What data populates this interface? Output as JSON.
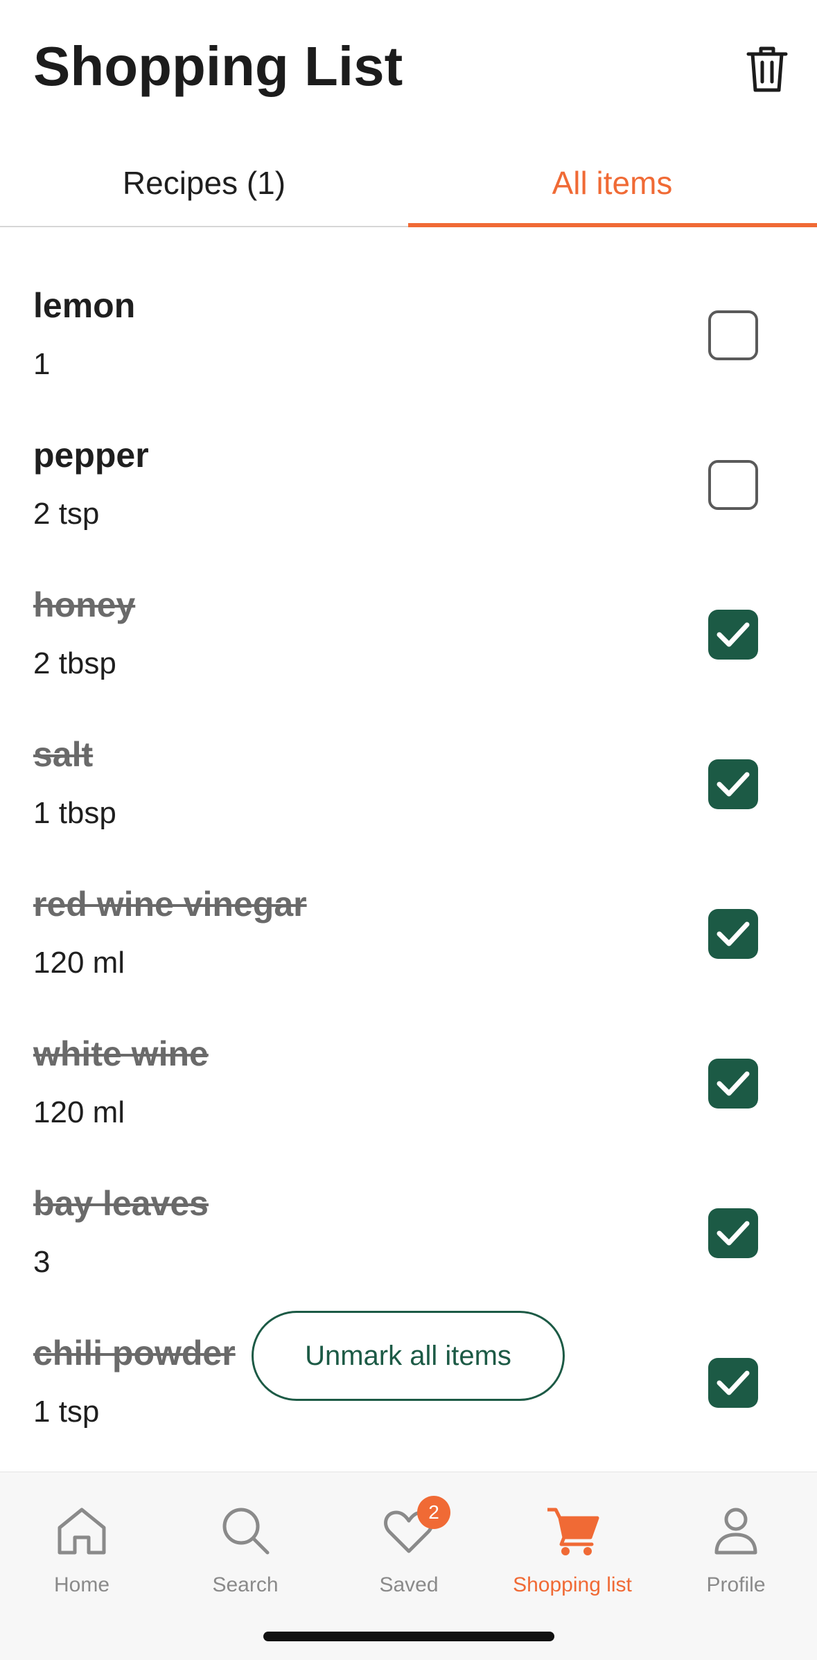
{
  "header": {
    "title": "Shopping List"
  },
  "tabs": [
    {
      "label": "Recipes (1)",
      "active": false
    },
    {
      "label": "All items",
      "active": true
    }
  ],
  "items": [
    {
      "name": "lemon",
      "qty": "1",
      "checked": false
    },
    {
      "name": "pepper",
      "qty": "2 tsp",
      "checked": false
    },
    {
      "name": "honey",
      "qty": "2 tbsp",
      "checked": true
    },
    {
      "name": "salt",
      "qty": "1 tbsp",
      "checked": true
    },
    {
      "name": "red wine vinegar",
      "qty": "120 ml",
      "checked": true
    },
    {
      "name": "white wine",
      "qty": "120 ml",
      "checked": true
    },
    {
      "name": "bay leaves",
      "qty": "3",
      "checked": true
    },
    {
      "name": "chili powder",
      "qty": "1 tsp",
      "checked": true
    }
  ],
  "unmark_label": "Unmark all items",
  "nav": [
    {
      "label": "Home",
      "icon": "home-icon"
    },
    {
      "label": "Search",
      "icon": "search-icon"
    },
    {
      "label": "Saved",
      "icon": "heart-icon",
      "badge": "2"
    },
    {
      "label": "Shopping list",
      "icon": "cart-icon",
      "active": true
    },
    {
      "label": "Profile",
      "icon": "profile-icon"
    }
  ],
  "colors": {
    "accent": "#f06a35",
    "check_green": "#1c5a45"
  }
}
